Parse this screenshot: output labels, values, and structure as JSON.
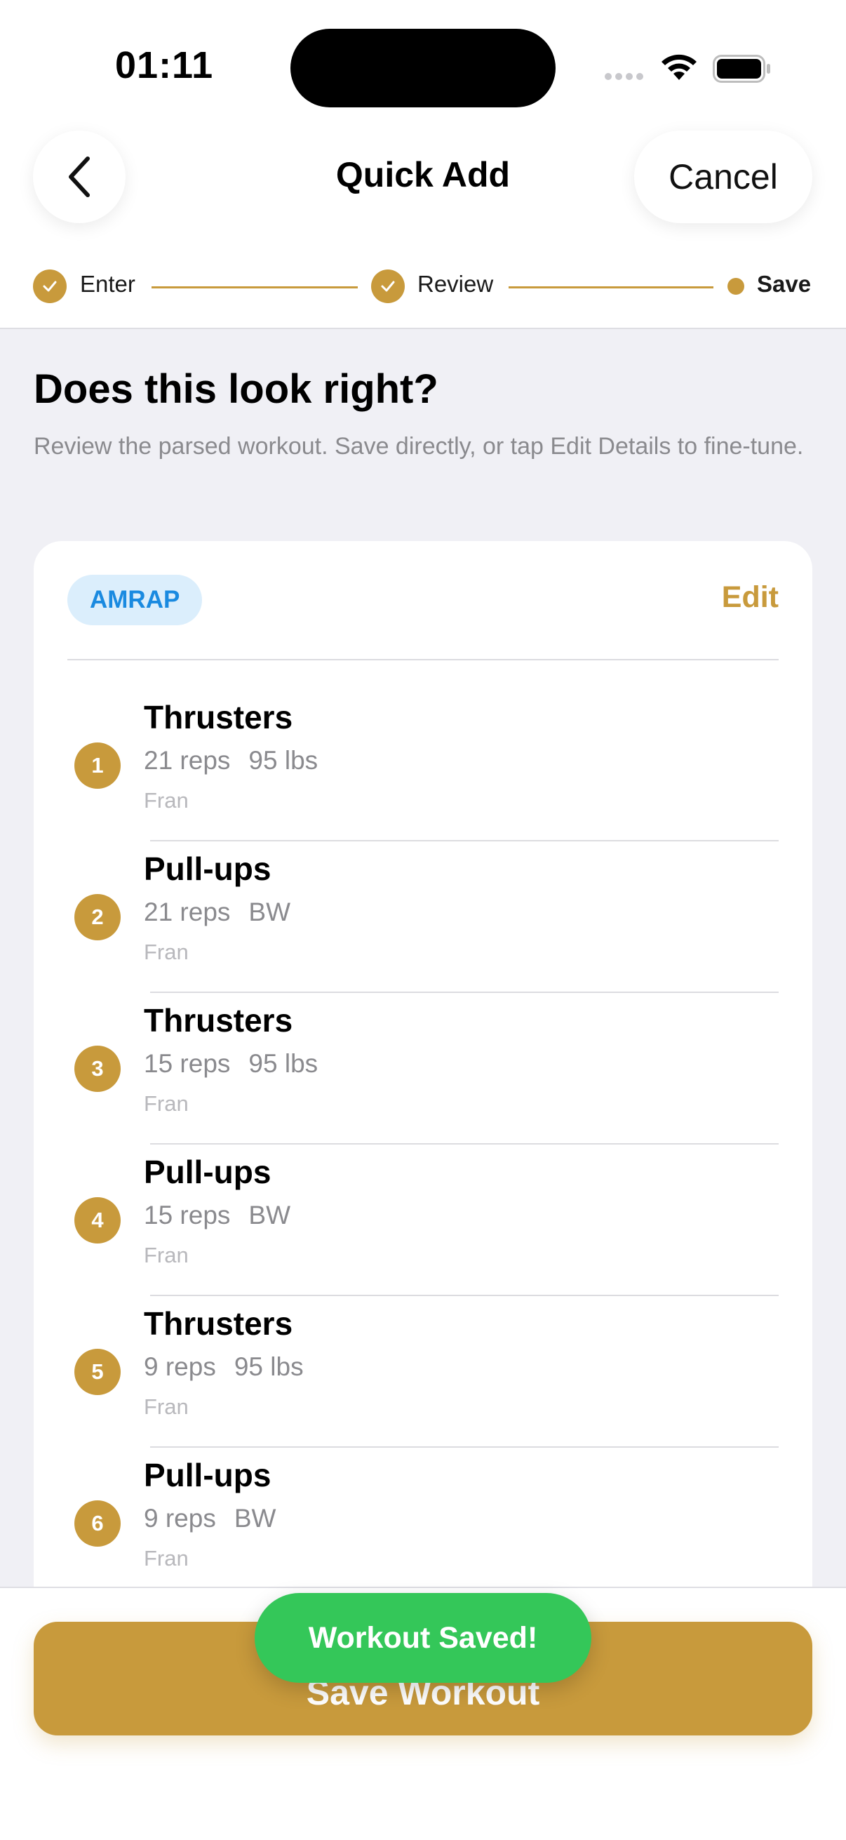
{
  "status_bar": {
    "time": "01:11"
  },
  "nav": {
    "title": "Quick Add",
    "cancel_label": "Cancel"
  },
  "stepper": {
    "steps": [
      {
        "label": "Enter",
        "state": "done"
      },
      {
        "label": "Review",
        "state": "done"
      },
      {
        "label": "Save",
        "state": "current"
      }
    ]
  },
  "main": {
    "heading": "Does this look right?",
    "subtext": "Review the parsed workout. Save directly, or tap Edit Details to fine-tune."
  },
  "card": {
    "badge": "AMRAP",
    "edit_label": "Edit",
    "exercises": [
      {
        "num": "1",
        "name": "Thrusters",
        "reps": "21 reps",
        "load": "95 lbs",
        "workout": "Fran"
      },
      {
        "num": "2",
        "name": "Pull-ups",
        "reps": "21 reps",
        "load": "BW",
        "workout": "Fran"
      },
      {
        "num": "3",
        "name": "Thrusters",
        "reps": "15 reps",
        "load": "95 lbs",
        "workout": "Fran"
      },
      {
        "num": "4",
        "name": "Pull-ups",
        "reps": "15 reps",
        "load": "BW",
        "workout": "Fran"
      },
      {
        "num": "5",
        "name": "Thrusters",
        "reps": "9 reps",
        "load": "95 lbs",
        "workout": "Fran"
      },
      {
        "num": "6",
        "name": "Pull-ups",
        "reps": "9 reps",
        "load": "BW",
        "workout": "Fran"
      }
    ]
  },
  "footer": {
    "save_label": "Save Workout"
  },
  "toast": {
    "message": "Workout Saved!"
  },
  "colors": {
    "accent": "#c89a3c",
    "success": "#34c759",
    "badge_text": "#1a8ae0",
    "background": "#f0f0f5"
  }
}
